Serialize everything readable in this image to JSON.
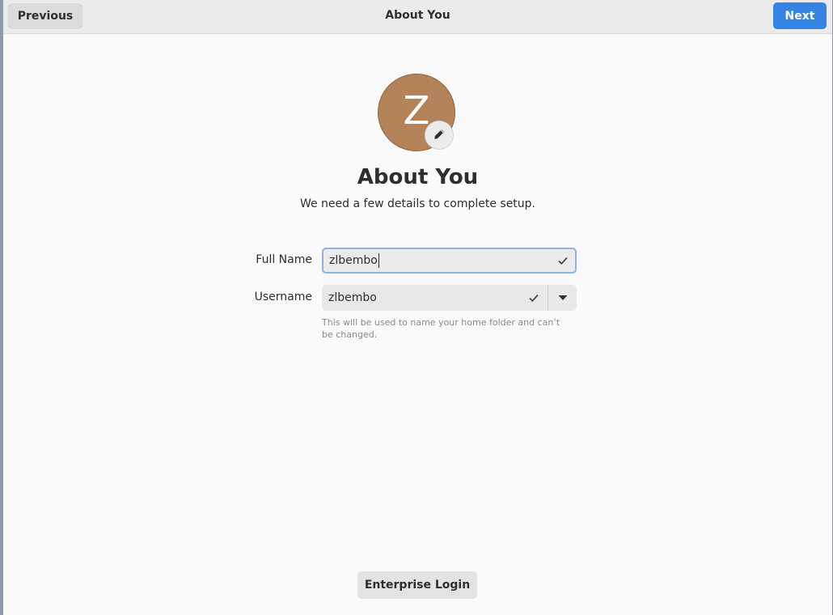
{
  "header": {
    "previous_label": "Previous",
    "title": "About You",
    "next_label": "Next"
  },
  "avatar": {
    "initial": "Z",
    "color": "#b5835a",
    "edit_icon": "pencil-icon"
  },
  "page": {
    "title": "About You",
    "subtitle": "We need a few details to complete setup."
  },
  "form": {
    "full_name": {
      "label": "Full Name",
      "value": "zlbembo",
      "status_icon": "check-icon"
    },
    "username": {
      "label": "Username",
      "value": "zlbembo",
      "status_icon": "check-icon",
      "dropdown_icon": "chevron-down-icon",
      "hint": "This will be used to name your home folder and can’t be changed."
    }
  },
  "footer": {
    "enterprise_label": "Enterprise Login"
  },
  "colors": {
    "accent": "#3584e4",
    "focus_ring": "#8fb4e3"
  }
}
